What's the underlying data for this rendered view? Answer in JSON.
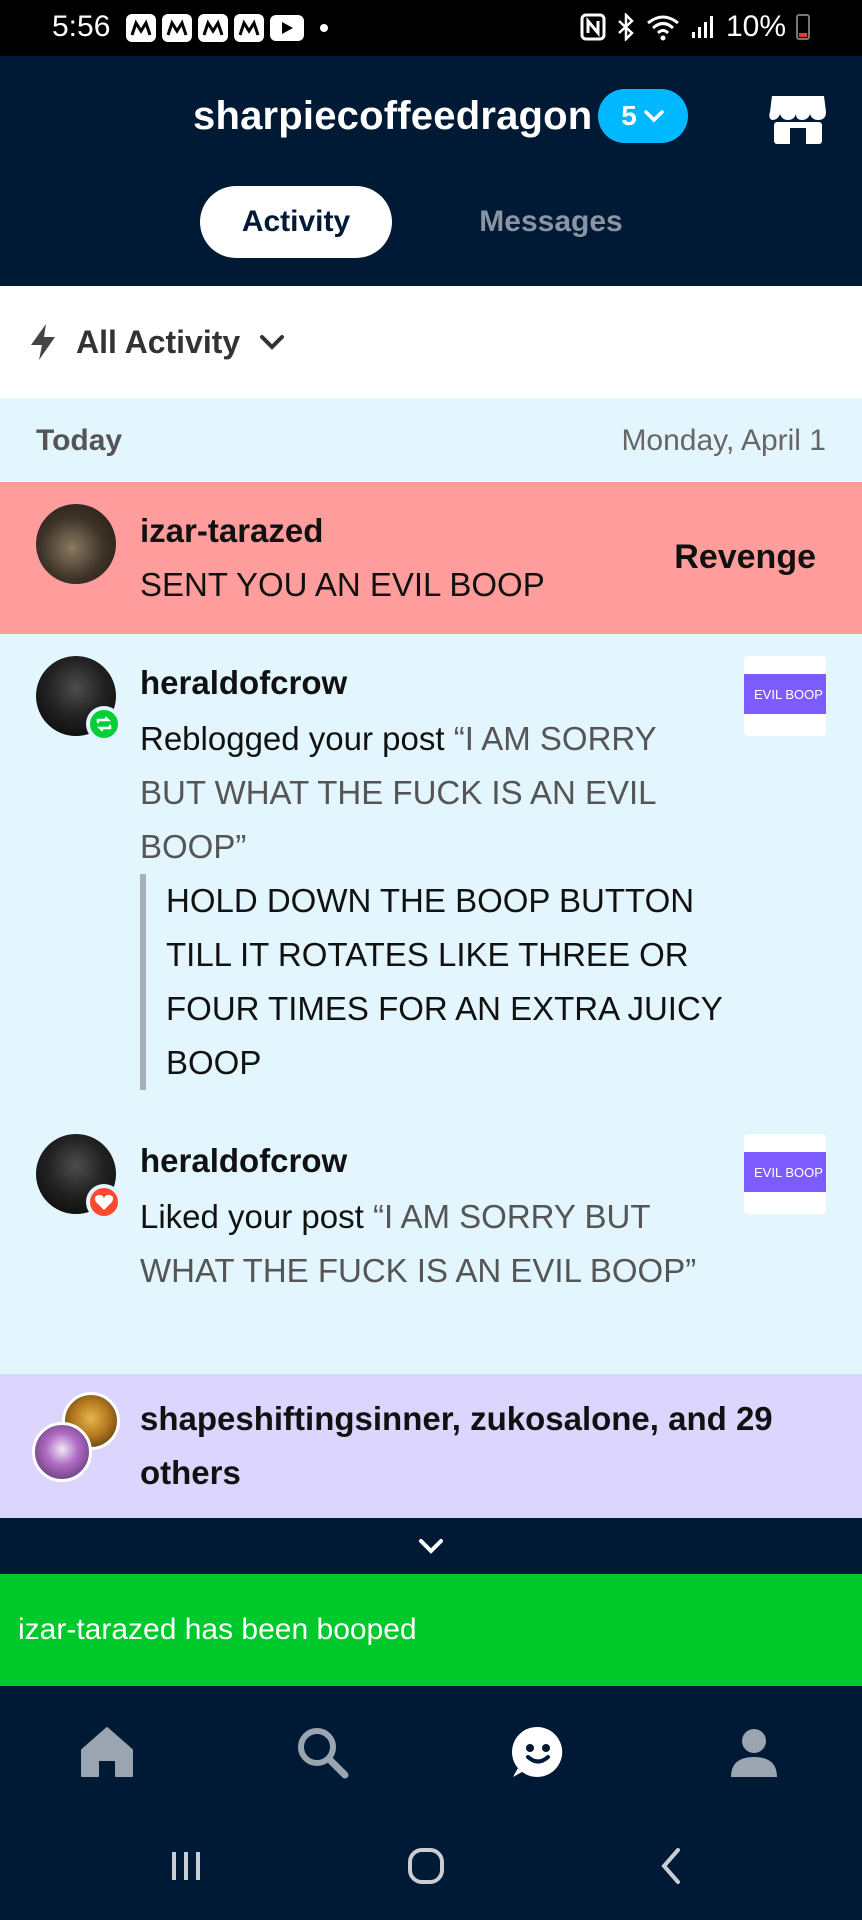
{
  "status_bar": {
    "time": "5:56",
    "battery": "10%"
  },
  "header": {
    "blog_name": "sharpiecoffeedragon",
    "blog_count": "5"
  },
  "tabs": {
    "activity": "Activity",
    "messages": "Messages"
  },
  "filter": {
    "label": "All Activity"
  },
  "section": {
    "today": "Today",
    "date": "Monday, April 1"
  },
  "boop": {
    "username": "izar-tarazed",
    "message": "SENT YOU AN EVIL BOOP",
    "action": "Revenge"
  },
  "activities": [
    {
      "username": "heraldofcrow",
      "action": "Reblogged your post ",
      "post_title": "“I AM SORRY BUT WHAT THE FUCK IS AN EVIL BOOP”",
      "comment": "HOLD DOWN THE BOOP BUTTON TILL IT ROTATES LIKE THREE OR FOUR TIMES FOR AN EXTRA JUICY BOOP",
      "thumb_label": "EVIL BOOP"
    },
    {
      "username": "heraldofcrow",
      "action": "Liked your post ",
      "post_title": "“I AM SORRY BUT WHAT THE FUCK IS AN EVIL BOOP”",
      "thumb_label": "EVIL BOOP"
    }
  ],
  "group": {
    "text": "shapeshiftingsinner, zukosalone, and 29 others"
  },
  "toast": {
    "message": "izar-tarazed has been booped"
  },
  "colors": {
    "navy": "#001935",
    "boop_bg": "#ff9c9c",
    "list_bg": "#e3f5fd",
    "group_bg": "#dcd6ff",
    "toast_bg": "#00c92c",
    "badge_blue": "#00b8ff"
  },
  "icons": {
    "bottom_nav": [
      "home-icon",
      "search-icon",
      "activity-face-icon",
      "profile-icon"
    ],
    "system_nav": [
      "recents-icon",
      "home-circle-icon",
      "back-icon"
    ]
  }
}
